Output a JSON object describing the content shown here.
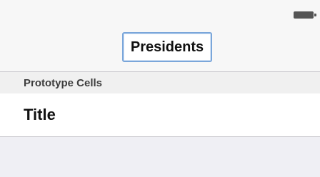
{
  "status_bar": {
    "battery_icon": "battery-icon"
  },
  "nav_bar": {
    "title": "Presidents"
  },
  "table": {
    "section_header": "Prototype Cells",
    "cell": {
      "title": "Title"
    }
  },
  "colors": {
    "selection_outline": "#7aa6da",
    "background": "#efeff4",
    "bar_background": "#f7f7f7"
  }
}
